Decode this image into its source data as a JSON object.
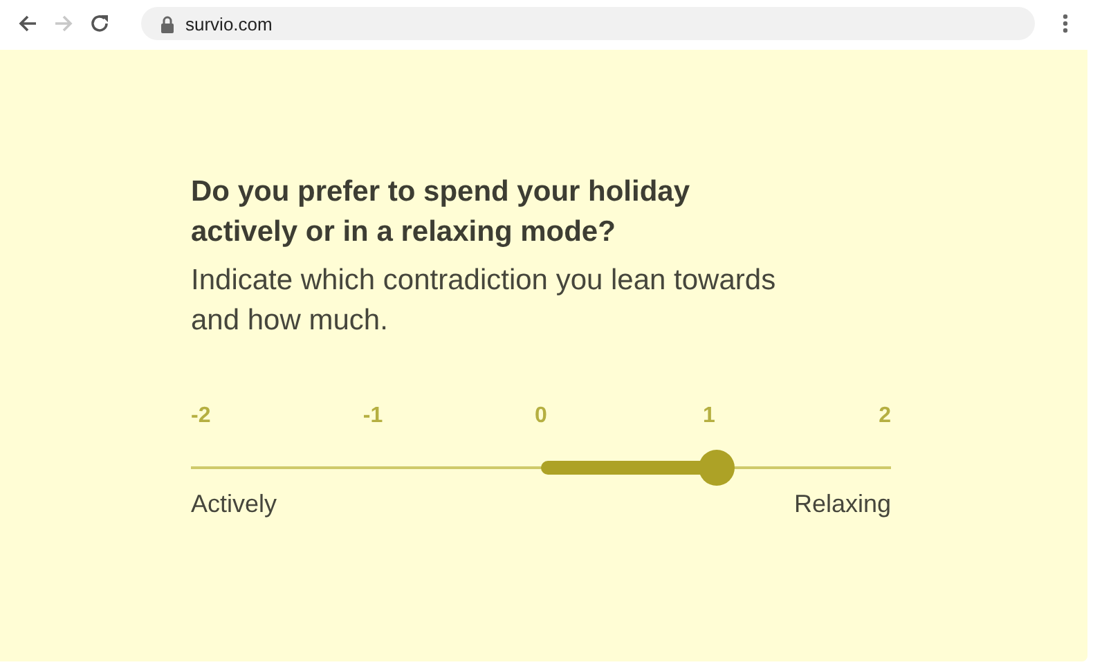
{
  "browser": {
    "back_disabled": false,
    "forward_disabled": true,
    "address": "survio.com"
  },
  "question": {
    "title": "Do you prefer to spend your holiday actively or in a relaxing mode?",
    "hint": "Indicate which contradiction you lean towards and how much."
  },
  "scale": {
    "ticks": [
      "-2",
      "-1",
      "0",
      "1",
      "2"
    ],
    "level": 0.75,
    "left_label": "Actively",
    "right_label": "Relaxing"
  }
}
